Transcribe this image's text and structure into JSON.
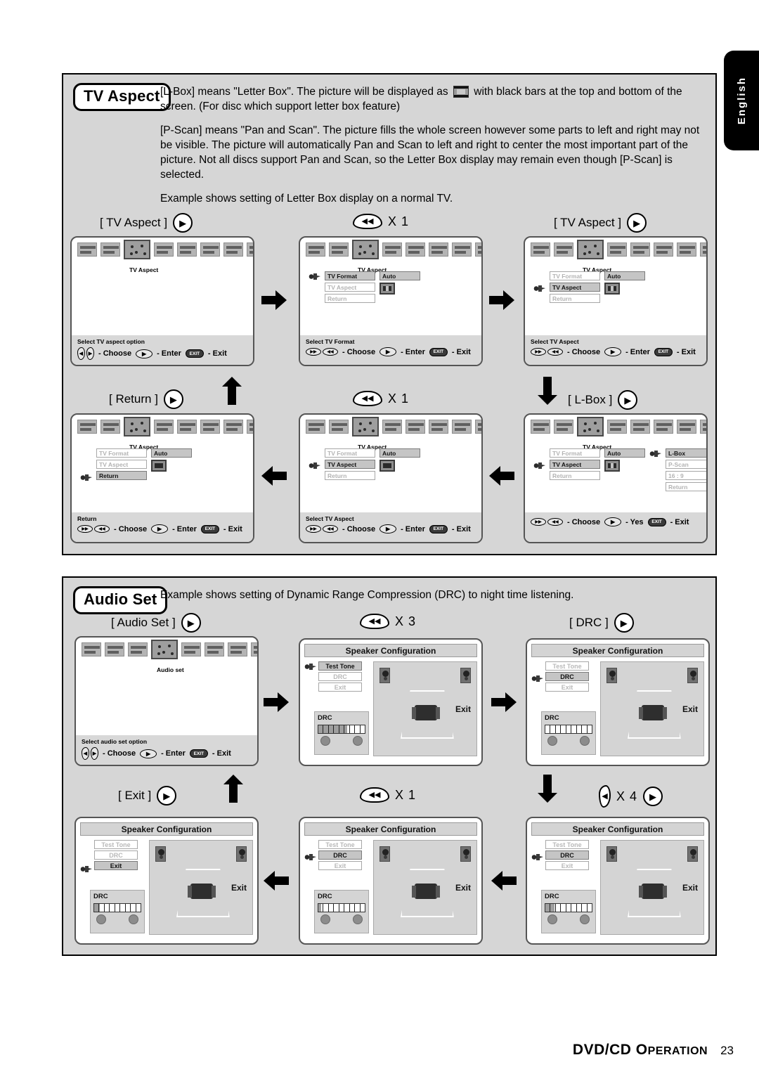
{
  "language_tab": "English",
  "footer": {
    "title_main": "DVD/CD O",
    "title_small": "PERATION",
    "page": "23"
  },
  "sections": [
    {
      "id": "tv-aspect",
      "badge": "TV Aspect",
      "paragraphs": [
        "[L-Box] means \"Letter Box\". The picture will be displayed as  with black bars at the top and bottom of the screen.  (For disc which support letter box feature)",
        "[P-Scan] means \"Pan and Scan\". The picture fills the whole screen however some parts to left and right may not be visible. The picture will automatically Pan and Scan to left and right to center the most important part of the picture.  Not all discs support Pan and Scan, so the Letter Box display may remain even though [P-Scan] is selected.",
        "Example shows setting of Letter Box display on a normal TV."
      ],
      "intro_part1": "[L-Box] means \"Letter Box\". The picture will be displayed as",
      "intro_part2": "with black bars at the top and",
      "intro_part3": "bottom of the screen.  (For disc which support letter box feature)"
    },
    {
      "id": "audio-set",
      "badge": "Audio Set",
      "description": "Example shows setting of Dynamic Range Compression (DRC) to night time listening."
    }
  ],
  "tv_steps": [
    {
      "label": "[ TV Aspect ]",
      "button": "play",
      "count": ""
    },
    {
      "label": "",
      "button": "rew",
      "count": "X 1"
    },
    {
      "label": "[ TV Aspect ]",
      "button": "play",
      "count": ""
    },
    {
      "label": "[ Return ]",
      "button": "play",
      "count": ""
    },
    {
      "label": "",
      "button": "rew",
      "count": "X 1"
    },
    {
      "label": "[ L-Box ]",
      "button": "play",
      "count": ""
    }
  ],
  "audio_steps": [
    {
      "label": "[ Audio Set ]",
      "button": "play",
      "count": ""
    },
    {
      "label": "",
      "button": "rew",
      "count": "X 3"
    },
    {
      "label": "[ DRC ]",
      "button": "play",
      "count": ""
    },
    {
      "label": "[ Exit ]",
      "button": "play",
      "count": ""
    },
    {
      "label": "",
      "button": "rew",
      "count": "X 1"
    },
    {
      "label": "",
      "button": "left-leaf",
      "count": "X 4",
      "extra_button": "play"
    }
  ],
  "tv_screens": [
    {
      "caption": "TV Aspect",
      "rows": [],
      "foot_title": "Select TV aspect option",
      "choose": "- Choose",
      "enter": "- Enter",
      "exit": "- Exit",
      "choose_key": "leaf-pair",
      "enter_label": "- Enter",
      "exit_label": "- Exit"
    },
    {
      "caption": "TV Aspect",
      "rows": [
        {
          "label": "TV Format",
          "on": true,
          "cursor": true,
          "value": "Auto",
          "value_on": true
        },
        {
          "label": "TV Aspect",
          "on": false,
          "cursor": false,
          "value": "thumb-side"
        },
        {
          "label": "Return",
          "on": false,
          "cursor": false,
          "value": ""
        }
      ],
      "foot_title": "Select TV Format",
      "choose_key": "pill-pair",
      "enter_label": "- Enter",
      "exit_label": "- Exit",
      "choose": "- Choose"
    },
    {
      "caption": "TV Aspect",
      "rows": [
        {
          "label": "TV Format",
          "on": false,
          "cursor": false,
          "value": "Auto",
          "value_on": true
        },
        {
          "label": "TV Aspect",
          "on": true,
          "cursor": true,
          "value": "thumb-side"
        },
        {
          "label": "Return",
          "on": false,
          "cursor": false,
          "value": ""
        }
      ],
      "foot_title": "Select TV Aspect",
      "choose_key": "pill-pair",
      "enter_label": "- Enter",
      "exit_label": "- Exit",
      "choose": "- Choose"
    },
    {
      "caption": "TV Aspect",
      "rows": [
        {
          "label": "TV Format",
          "on": false,
          "cursor": false,
          "value": "Auto",
          "value_on": true
        },
        {
          "label": "TV Aspect",
          "on": false,
          "cursor": false,
          "value": "thumb-bars"
        },
        {
          "label": "Return",
          "on": true,
          "cursor": true,
          "value": ""
        }
      ],
      "foot_title": "Return",
      "choose_key": "pill-pair",
      "enter_label": "- Enter",
      "exit_label": "- Exit",
      "choose": "- Choose"
    },
    {
      "caption": "TV Aspect",
      "rows": [
        {
          "label": "TV Format",
          "on": false,
          "cursor": false,
          "value": "Auto",
          "value_on": true
        },
        {
          "label": "TV Aspect",
          "on": true,
          "cursor": true,
          "value": "thumb-bars"
        },
        {
          "label": "Return",
          "on": false,
          "cursor": false,
          "value": ""
        }
      ],
      "foot_title": "Select TV Aspect",
      "choose_key": "pill-pair",
      "enter_label": "- Enter",
      "exit_label": "- Exit",
      "choose": "- Choose"
    },
    {
      "caption": "TV Aspect",
      "rows": [
        {
          "label": "TV Format",
          "on": false,
          "cursor": false,
          "value": "Auto",
          "value_on": true
        },
        {
          "label": "TV Aspect",
          "on": true,
          "cursor": true,
          "value": "thumb-side"
        },
        {
          "label": "Return",
          "on": false,
          "cursor": false,
          "value": ""
        }
      ],
      "submenu": [
        {
          "label": "L-Box",
          "on": true,
          "cursor": true
        },
        {
          "label": "P-Scan",
          "on": false,
          "cursor": false
        },
        {
          "label": "16 : 9",
          "on": false,
          "cursor": false
        },
        {
          "label": "Return",
          "on": false,
          "cursor": false
        }
      ],
      "foot_title": "",
      "choose_key": "pill-pair",
      "enter_label": "- Yes",
      "exit_label": "- Exit",
      "choose": "- Choose"
    }
  ],
  "audio_menu_screen": {
    "caption": "Audio set",
    "foot_title": "Select audio set option",
    "choose": "- Choose",
    "enter_label": "- Enter",
    "exit_label": "- Exit"
  },
  "speaker_screens": [
    {
      "title": "Speaker Configuration",
      "items": [
        {
          "label": "Test Tone",
          "on": true,
          "cursor": true
        },
        {
          "label": "DRC",
          "on": false,
          "cursor": false
        },
        {
          "label": "Exit",
          "on": false,
          "cursor": false
        }
      ],
      "drc_label": "DRC",
      "drc_fill_pct": 62,
      "exit_label": "Exit"
    },
    {
      "title": "Speaker Configuration",
      "items": [
        {
          "label": "Test Tone",
          "on": false,
          "cursor": false
        },
        {
          "label": "DRC",
          "on": true,
          "cursor": true
        },
        {
          "label": "Exit",
          "on": false,
          "cursor": false
        }
      ],
      "drc_label": "DRC",
      "drc_fill_pct": 0,
      "exit_label": "Exit"
    },
    {
      "title": "Speaker Configuration",
      "items": [
        {
          "label": "Test Tone",
          "on": false,
          "cursor": false
        },
        {
          "label": "DRC",
          "on": false,
          "cursor": false
        },
        {
          "label": "Exit",
          "on": true,
          "cursor": true
        }
      ],
      "drc_label": "DRC",
      "drc_fill_pct": 12,
      "exit_label": "Exit"
    },
    {
      "title": "Speaker Configuration",
      "items": [
        {
          "label": "Test Tone",
          "on": false,
          "cursor": false
        },
        {
          "label": "DRC",
          "on": true,
          "cursor": true
        },
        {
          "label": "Exit",
          "on": false,
          "cursor": false
        }
      ],
      "drc_label": "DRC",
      "drc_fill_pct": 6,
      "exit_label": "Exit"
    },
    {
      "title": "Speaker Configuration",
      "items": [
        {
          "label": "Test Tone",
          "on": false,
          "cursor": false
        },
        {
          "label": "DRC",
          "on": true,
          "cursor": true
        },
        {
          "label": "Exit",
          "on": false,
          "cursor": false
        }
      ],
      "drc_label": "DRC",
      "drc_fill_pct": 20,
      "exit_label": "Exit"
    }
  ],
  "glyphs": {
    "play": "▶",
    "rewind": "◀◀",
    "left": "◀",
    "exit_key": "EXIT"
  },
  "menu_icon_captions": {
    "tv": "TV Aspect",
    "audio": "Audio set"
  }
}
